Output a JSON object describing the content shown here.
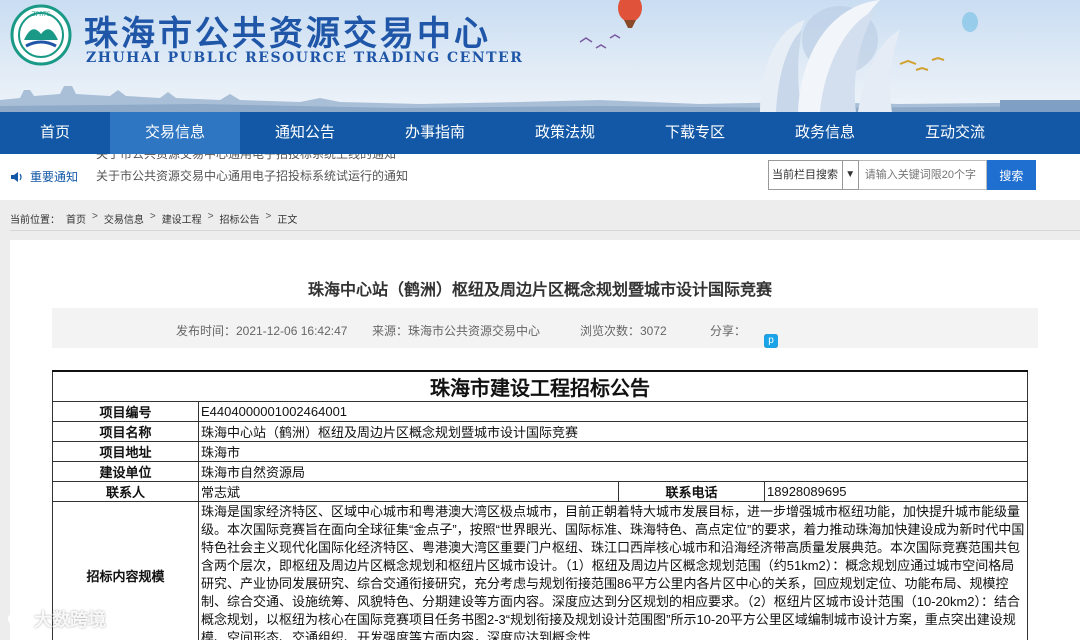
{
  "header": {
    "logo_text": "ZPRTC",
    "site_title_cn": "珠海市公共资源交易中心",
    "site_title_en": "ZHUHAI PUBLIC RESOURCE TRADING CENTER"
  },
  "nav": {
    "items": [
      "首页",
      "交易信息",
      "通知公告",
      "办事指南",
      "政策法规",
      "下载专区",
      "政务信息",
      "互动交流"
    ],
    "active_index": 1
  },
  "notice": {
    "label": "重要通知",
    "items": [
      "关于市公共资源交易中心通用电子招投标系统上线的通知",
      "关于市公共资源交易中心通用电子招投标系统试运行的通知"
    ]
  },
  "search": {
    "scope": "当前栏目搜索",
    "placeholder": "请输入关键词限20个字",
    "button": "搜索"
  },
  "breadcrumb": {
    "prefix": "当前位置：",
    "items": [
      "首页",
      "交易信息",
      "建设工程",
      "招标公告",
      "正文"
    ]
  },
  "article": {
    "title": "珠海中心站（鹤洲）枢纽及周边片区概念规划暨城市设计国际竞赛",
    "publish_time": "发布时间：2021-12-06 16:42:47",
    "source": "来源：珠海市公共资源交易中心",
    "views": "浏览次数：3072",
    "share_label": "分享："
  },
  "tender": {
    "heading": "珠海市建设工程招标公告",
    "rows": [
      {
        "label": "项目编号",
        "value": "E4404000001002464001"
      },
      {
        "label": "项目名称",
        "value": "珠海中心站（鹤洲）枢纽及周边片区概念规划暨城市设计国际竞赛"
      },
      {
        "label": "项目地址",
        "value": "珠海市"
      },
      {
        "label": "建设单位",
        "value": "珠海市自然资源局"
      }
    ],
    "contact_label": "联系人",
    "contact_value": "常志斌",
    "phone_label": "联系电话",
    "phone_value": "18928089695",
    "scope_label": "招标内容规模",
    "scope_text": "珠海是国家经济特区、区域中心城市和粤港澳大湾区极点城市，目前正朝着特大城市发展目标，进一步增强城市枢纽功能，加快提升城市能级量级。本次国际竞赛旨在面向全球征集“金点子”，按照“世界眼光、国际标准、珠海特色、高点定位”的要求，着力推动珠海加快建设成为新时代中国特色社会主义现代化国际化经济特区、粤港澳大湾区重要门户枢纽、珠江口西岸核心城市和沿海经济带高质量发展典范。本次国际竞赛范围共包含两个层次，即枢纽及周边片区概念规划和枢纽片区城市设计。（1）枢纽及周边片区概念规划范围（约51km2）：概念规划应通过城市空间格局研究、产业协同发展研究、综合交通衔接研究，充分考虑与规划衔接范围86平方公里内各片区中心的关系，回应规划定位、功能布局、规模控制、综合交通、设施统筹、风貌特色、分期建设等方面内容。深度应达到分区规划的相应要求。（2）枢纽片区城市设计范围（10-20km2）：结合概念规划，以枢纽为核心在国际竞赛项目任务书图2-3“规划衔接及规划设计范围图”所示10-20平方公里区域编制城市设计方案，重点突出建设规模、空间形态、交通组织、开发强度等方面内容，深度应达到概念性"
  },
  "watermark": "大数跨境",
  "colors": {
    "nav_bg": "#1358a6",
    "nav_active": "#2f76c2",
    "brand_text": "#1f56a8",
    "search_button": "#1f6fd1"
  }
}
